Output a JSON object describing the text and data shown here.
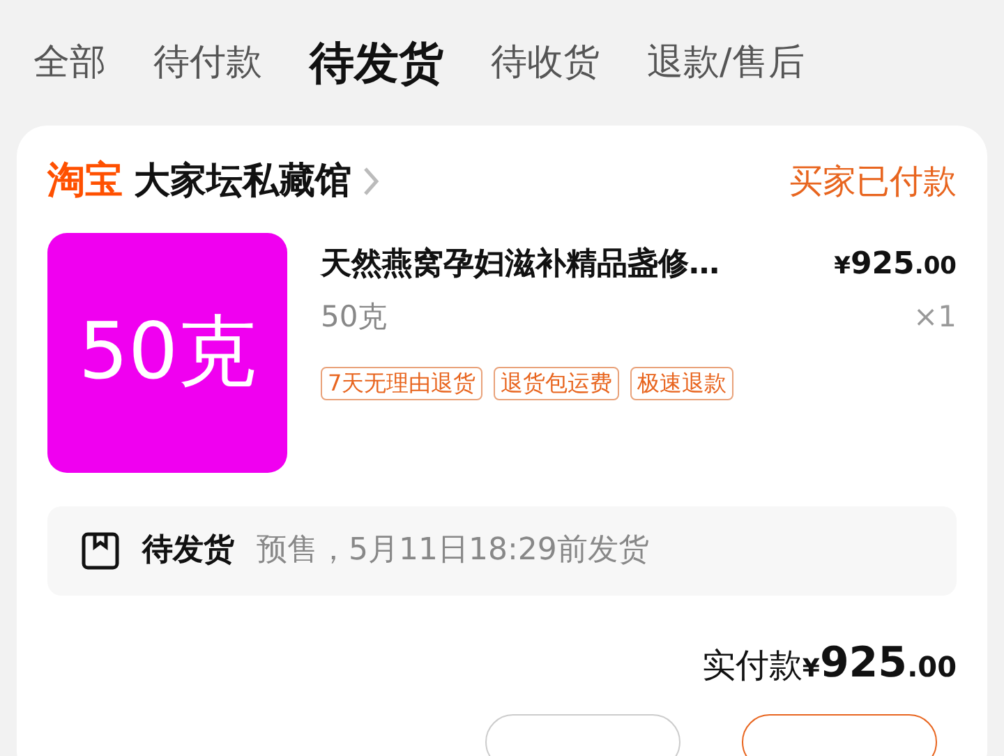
{
  "tabs": [
    {
      "label": "全部",
      "selected": false
    },
    {
      "label": "待付款",
      "selected": false
    },
    {
      "label": "待发货",
      "selected": true
    },
    {
      "label": "待收货",
      "selected": false
    },
    {
      "label": "退款/售后",
      "selected": false
    }
  ],
  "order": {
    "platform": "淘宝",
    "shop": "大家坛私藏馆",
    "status": "买家已付款",
    "item": {
      "image_text": "50克",
      "title": "天然燕窝孕妇滋补精品盏修…",
      "price": {
        "symbol": "¥",
        "integer": "925",
        "decimal": ".00"
      },
      "spec": "50克",
      "quantity": "×1",
      "tags": [
        "7天无理由退货",
        "退货包运费",
        "极速退款"
      ]
    },
    "shipping": {
      "status": "待发货",
      "note": "预售，5月11日18:29前发货"
    },
    "total": {
      "label": "实付款",
      "symbol": "¥",
      "integer": "925",
      "decimal": ".00"
    },
    "actions": [
      {
        "kind": "plain"
      },
      {
        "kind": "primary"
      }
    ]
  }
}
